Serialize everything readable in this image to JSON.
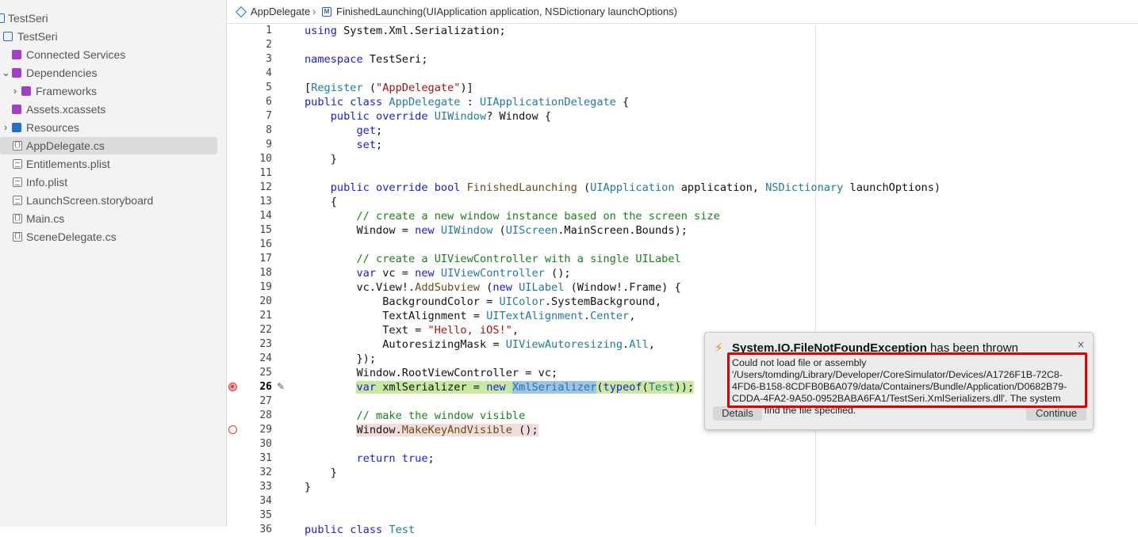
{
  "sidebar": {
    "items": [
      {
        "label": "TestSeri"
      },
      {
        "label": "TestSeri"
      },
      {
        "label": "Connected Services"
      },
      {
        "label": "Dependencies",
        "chevron": "⌄"
      },
      {
        "label": "Frameworks",
        "chevron": "›"
      },
      {
        "label": "Assets.xcassets"
      },
      {
        "label": "Resources",
        "chevron": "›"
      },
      {
        "label": "AppDelegate.cs"
      },
      {
        "label": "Entitlements.plist"
      },
      {
        "label": "Info.plist"
      },
      {
        "label": "LaunchScreen.storyboard"
      },
      {
        "label": "Main.cs"
      },
      {
        "label": "SceneDelegate.cs"
      }
    ]
  },
  "breadcrumb": {
    "class_name": "AppDelegate",
    "separator": "›",
    "method_name": "FinishedLaunching(UIApplication application, NSDictionary launchOptions)"
  },
  "editor": {
    "current_line": 26,
    "line_numbers": [
      "1",
      "2",
      "3",
      "4",
      "5",
      "6",
      "7",
      "8",
      "9",
      "10",
      "11",
      "12",
      "13",
      "14",
      "15",
      "16",
      "17",
      "18",
      "19",
      "20",
      "21",
      "22",
      "23",
      "24",
      "25",
      "26",
      "27",
      "28",
      "29",
      "30",
      "31",
      "32",
      "33",
      "34",
      "35",
      "36"
    ]
  },
  "exception": {
    "bolt": "⚡",
    "type": "System.IO.FileNotFoundException",
    "suffix": " has been thrown",
    "close": "×",
    "message": "Could not load file or assembly '/Users/tomding/Library/Developer/CoreSimulator/Devices/A1726F1B-72C8-4FD6-B158-8CDFB0B6A079/data/Containers/Bundle/Application/D0682B79-CDDA-4FA2-9A50-0952BABA6FA1/TestSeri.XmlSerializers.dll'. The system cannot find the file specified.",
    "details_label": "Details",
    "continue_label": "Continue"
  },
  "colors": {
    "keyword": "#1b1bd8",
    "type": "#1f7a9c",
    "string": "#a31515",
    "comment": "#1c7d1c",
    "highlight_box": "#e00000"
  }
}
